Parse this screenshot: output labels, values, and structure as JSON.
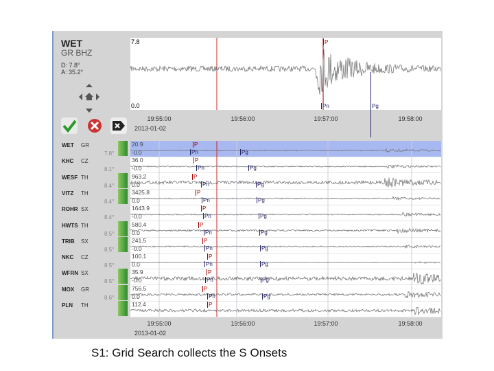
{
  "header": {
    "station": "WET",
    "network_channel": "GR BHZ",
    "distance": "D: 7.8°",
    "azimuth": "A: 35.2°"
  },
  "top_plot": {
    "max": "7.8",
    "min": "0.0",
    "picks": [
      {
        "label": "P",
        "type": "p"
      },
      {
        "label": "Pn",
        "type": "b"
      },
      {
        "label": "Pg",
        "type": "b"
      }
    ]
  },
  "buttons": {
    "accept": "accept-button",
    "reject": "reject-button",
    "delete": "delete-button"
  },
  "time_axis": {
    "ticks": [
      "19:55:00",
      "19:56:00",
      "19:57:00",
      "19:58:00"
    ],
    "date": "2013-01-02"
  },
  "stations": [
    {
      "name": "WET",
      "net": "GR",
      "max": "20.9",
      "min": "-0.0",
      "dist": "7.8°",
      "selected": true,
      "picks": [
        "P",
        "Pn",
        "Pg"
      ]
    },
    {
      "name": "KHC",
      "net": "CZ",
      "max": "36.0",
      "min": "-0.0",
      "dist": "8.1°",
      "picks": [
        "P",
        "Pn",
        "Pg"
      ]
    },
    {
      "name": "WESF",
      "net": "TH",
      "max": "963.2",
      "min": "0.0",
      "dist": "8.4°",
      "picks": [
        "P",
        "Pn",
        "Pg"
      ]
    },
    {
      "name": "VITZ",
      "net": "TH",
      "max": "3425.8",
      "min": "0.0",
      "dist": "8.4°",
      "picks": [
        "P",
        "Pn",
        "Pg"
      ]
    },
    {
      "name": "ROHR",
      "net": "SX",
      "max": "1643.9",
      "min": "-0.0",
      "dist": "8.4°",
      "picks": [
        "P",
        "Pn",
        "Pg"
      ]
    },
    {
      "name": "HWTS",
      "net": "TH",
      "max": "580.4",
      "min": "0.0",
      "dist": "8.5°",
      "picks": [
        "P",
        "Pn",
        "Pg"
      ]
    },
    {
      "name": "TRIB",
      "net": "SX",
      "max": "241.5",
      "min": "-0.0",
      "dist": "8.5°",
      "picks": [
        "P",
        "Pn",
        "Pg"
      ]
    },
    {
      "name": "NKC",
      "net": "CZ",
      "max": "100.1",
      "min": "0.0",
      "dist": "8.5°",
      "picks": [
        "P",
        "Pn",
        "Pg"
      ]
    },
    {
      "name": "WFRN",
      "net": "SX",
      "max": "35.9",
      "min": "-0.0",
      "dist": "8.5°",
      "picks": [
        "P",
        "Pn",
        "Pg"
      ]
    },
    {
      "name": "MOX",
      "net": "GR",
      "max": "756.5",
      "min": "0.0",
      "dist": "8.6°",
      "picks": [
        "P",
        "Pn",
        "Pg"
      ]
    },
    {
      "name": "PLN",
      "net": "TH",
      "max": "112.4",
      "min": "",
      "dist": "",
      "picks": [
        "P"
      ]
    }
  ],
  "caption": "S1: Grid Search collects the S Onsets",
  "colors": {
    "selected_row": "#a7b9f0",
    "p_pick": "#aa0000",
    "phase_pick": "#222266",
    "marker": "#cc2222"
  }
}
